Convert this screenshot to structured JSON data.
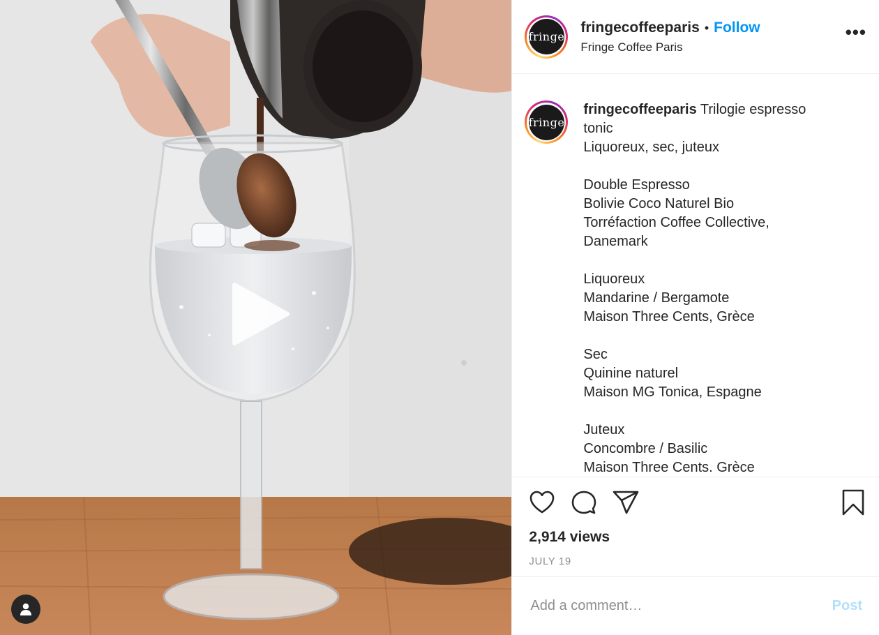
{
  "account": {
    "username": "fringecoffeeparis",
    "avatar_text": "fringe",
    "follow_label": "Follow",
    "separator": "•",
    "location": "Fringe Coffee Paris",
    "more_icon": "more-options-icon"
  },
  "caption": {
    "username": "fringecoffeeparis",
    "first_line": " Trilogie espresso",
    "body": "tonic\nLiquoreux, sec, juteux\n\nDouble Espresso\nBolivie Coco Naturel Bio\nTorréfaction Coffee Collective,\nDanemark\n\nLiquoreux\nMandarine / Bergamote\nMaison Three Cents, Grèce\n\nSec\nQuinine naturel\nMaison MG Tonica, Espagne\n\nJuteux\nConcombre / Basilic\nMaison Three Cents. Grèce"
  },
  "actions": {
    "like_icon": "heart-icon",
    "comment_icon": "comment-bubble-icon",
    "share_icon": "paper-plane-icon",
    "save_icon": "bookmark-icon"
  },
  "stats": {
    "views": "2,914 views",
    "date": "JULY 19"
  },
  "comment_box": {
    "placeholder": "Add a comment…",
    "post_label": "Post"
  },
  "media": {
    "type": "video",
    "play_icon": "play-icon",
    "user_tag_icon": "user-tag-icon"
  },
  "colors": {
    "accent": "#0095f6",
    "post_disabled": "#b2dffc",
    "text": "#262626",
    "muted": "#8e8e8e"
  }
}
